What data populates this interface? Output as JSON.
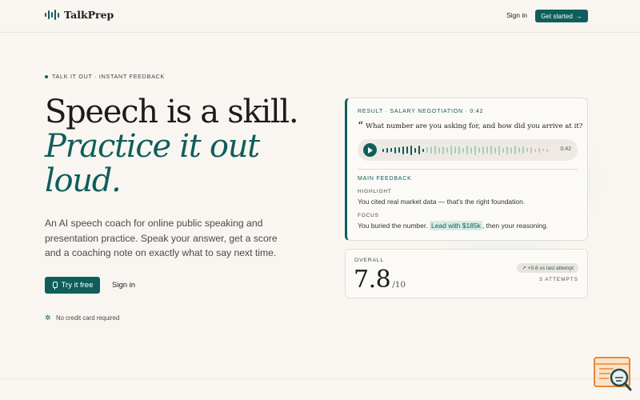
{
  "header": {
    "brand": "TalkPrep",
    "signin_label": "Sign in",
    "get_started_label": "Get started",
    "get_started_icon": "arrow-right-icon"
  },
  "hero": {
    "eyebrow": "TALK IT OUT · INSTANT FEEDBACK",
    "headline_line1": "Speech is a skill.",
    "headline_line2": "Practice it out",
    "headline_line3": "loud.",
    "lede": "An AI speech coach for online public speaking and presentation practice. Speak your answer, get a score and a coaching note on exactly what to say next time.",
    "try_label": "Try it free",
    "signin_label": "Sign in",
    "no_card": "No credit card required"
  },
  "result_card": {
    "header": "RESULT · SALARY NEGOTIATION · 0:42",
    "quote_mark": "“",
    "question": "What number are you asking for, and how did you arrive at it?",
    "time": "0:42",
    "main_feedback": "MAIN FEEDBACK",
    "highlight_label": "HIGHLIGHT",
    "highlight_text": "You cited real market data — that's the right foundation.",
    "focus_label": "FOCUS",
    "focus_pre": "You buried the number.",
    "focus_mark": "Lead with $185k",
    "focus_post": ", then your reasoning."
  },
  "score_card": {
    "overall_label": "OVERALL",
    "score": "7.8",
    "denominator": "/10",
    "delta": "↗ +0.6 vs last attempt",
    "attempts": "3 ATTEMPTS"
  },
  "colors": {
    "accent": "#0f5e5c",
    "background": "#f9f6f1",
    "highlight_bg": "#d6ece6"
  }
}
